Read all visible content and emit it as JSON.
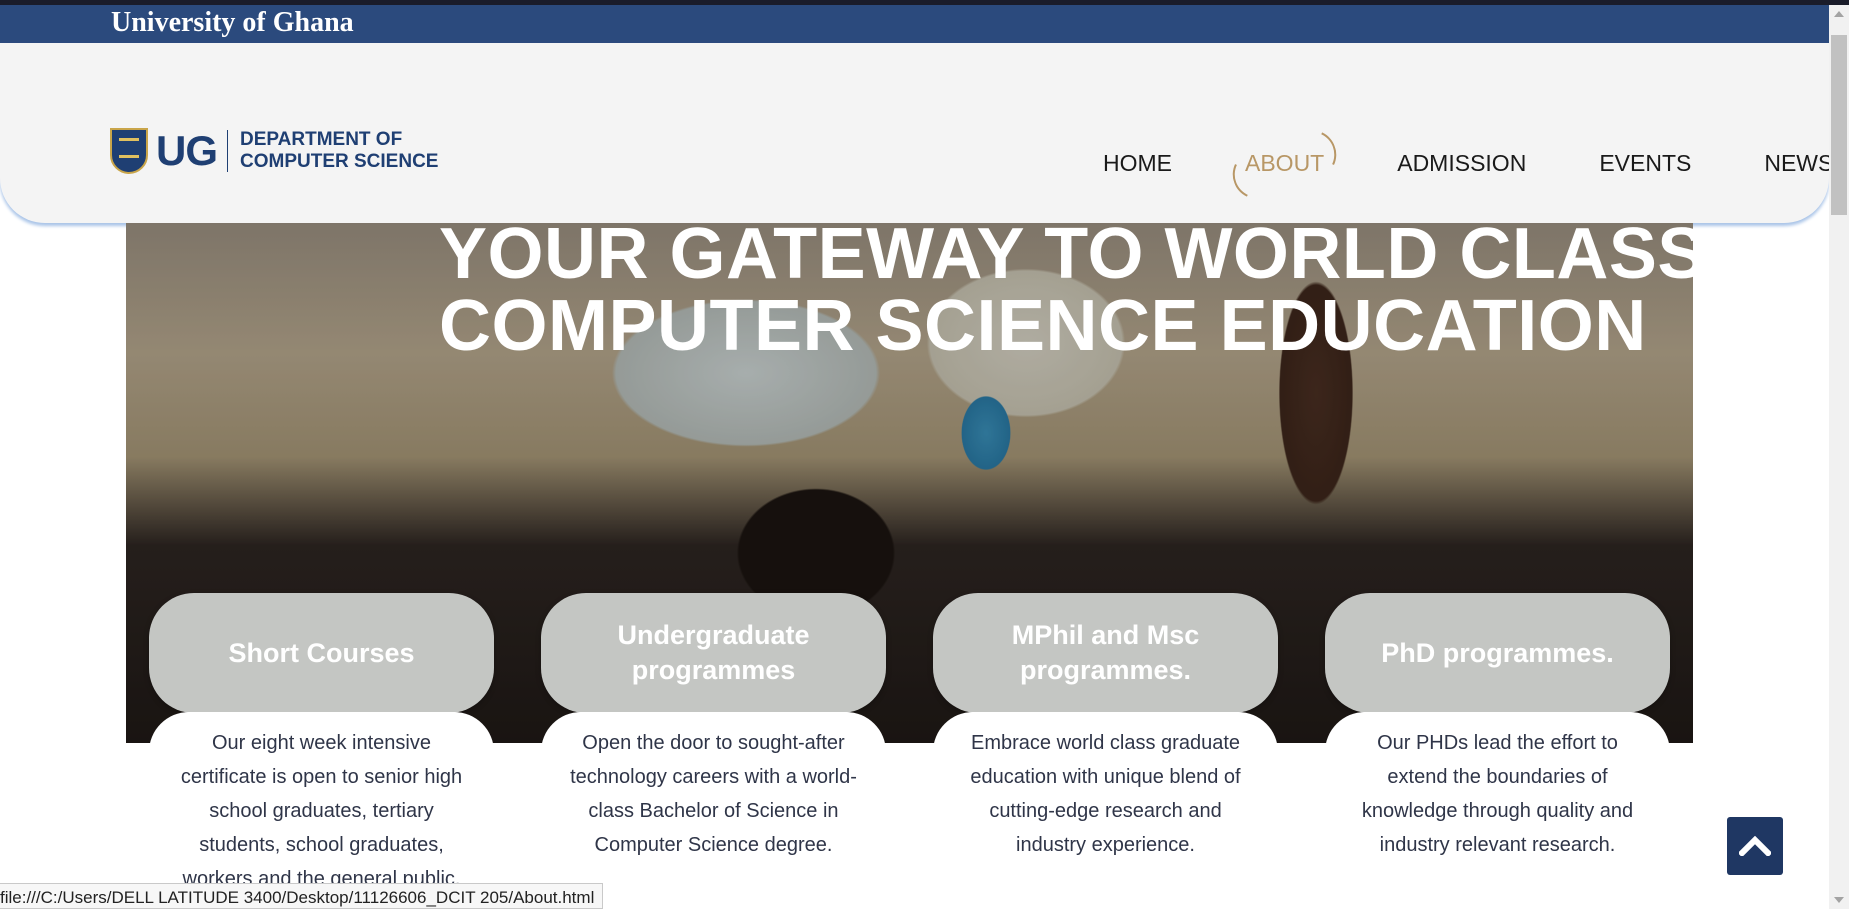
{
  "brand_bar": {
    "university_name": "University of Ghana"
  },
  "logo": {
    "abbr": "UG",
    "dept_line1": "DEPARTMENT OF",
    "dept_line2": "COMPUTER SCIENCE"
  },
  "nav": {
    "items": [
      {
        "label": "HOME",
        "active": false
      },
      {
        "label": "ABOUT",
        "active": true
      },
      {
        "label": "ADMISSION",
        "active": false
      },
      {
        "label": "EVENTS",
        "active": false
      },
      {
        "label": "NEWS",
        "active": false
      }
    ],
    "active_color": "#b89766"
  },
  "hero": {
    "title_line1": "YOUR GATEWAY TO WORLD CLASS",
    "title_line2": "COMPUTER SCIENCE EDUCATION"
  },
  "programs": [
    {
      "title": "Short Courses",
      "description": "Our eight week intensive certificate is open to senior high school graduates, tertiary students, school graduates, workers and the general public."
    },
    {
      "title": "Undergraduate programmes",
      "description": "Open the door to sought-after technology careers with a world-class Bachelor of Science in Computer Science degree."
    },
    {
      "title": "MPhil and Msc programmes.",
      "description": "Embrace world class graduate education with unique blend of cutting-edge research and industry experience."
    },
    {
      "title": "PhD programmes.",
      "description": "Our PHDs lead the effort to extend the boundaries of knowledge through quality and industry relevant research."
    }
  ],
  "scroll_top_button": {
    "icon": "chevron-up-icon"
  },
  "status_bar": {
    "url": "file:///C:/Users/DELL LATITUDE 3400/Desktop/11126606_DCIT 205/About.html"
  },
  "colors": {
    "brand_blue": "#2b4a7d",
    "card_grey": "#c4c6c3",
    "scroll_button": "#1f3763"
  }
}
